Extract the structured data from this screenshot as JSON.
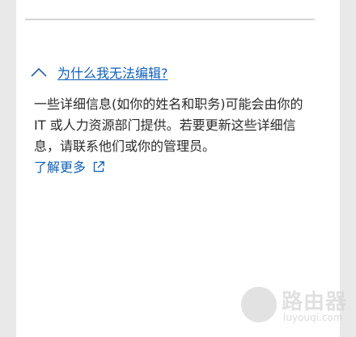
{
  "panel": {
    "toggle_label": "为什么我无法编辑?",
    "toggle_icon": "chevron-up-icon",
    "description": "一些详细信息(如你的姓名和职务)可能会由你的 IT 或人力资源部门提供。若要更新这些详细信息，请联系他们或你的管理员。",
    "learn_more_label": "了解更多",
    "learn_more_icon": "external-link-icon",
    "link_color": "#0f5fb8"
  },
  "watermark": {
    "text": "路由器",
    "subtext": "luyouqi.com"
  }
}
